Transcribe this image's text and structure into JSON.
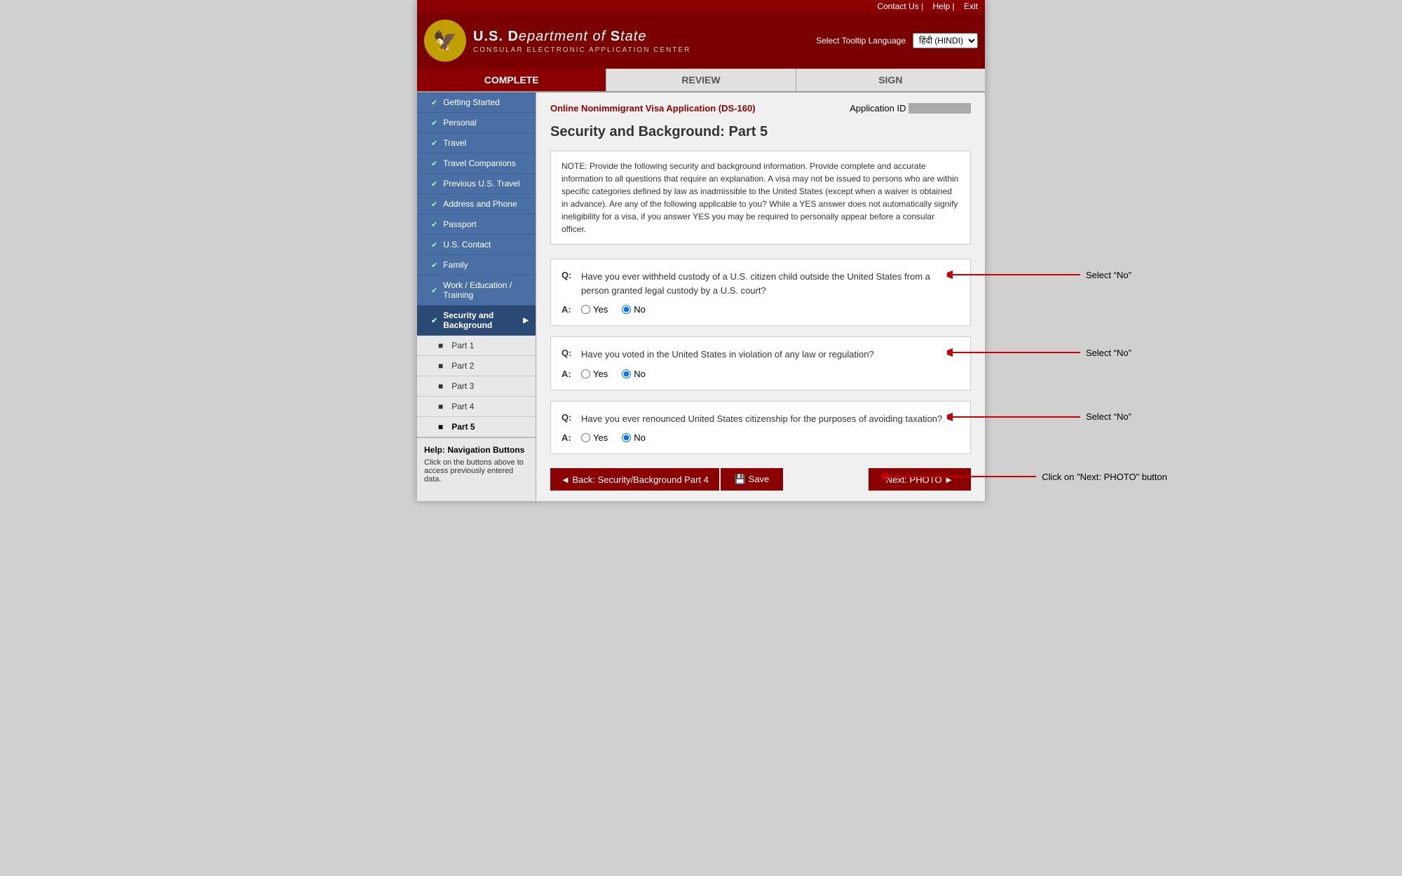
{
  "top_nav": {
    "contact_us": "Contact Us",
    "help": "Help",
    "exit": "Exit",
    "tooltip_label": "Select Tooltip Language",
    "language_selected": "हिंदी (HINDI)"
  },
  "agency": {
    "dept_line1": "U.S. DEPARTMENT",
    "dept_line2": "of STATE",
    "sub_title": "CONSULAR ELECTRONIC APPLICATION CENTER"
  },
  "tabs": [
    {
      "label": "COMPLETE",
      "state": "active"
    },
    {
      "label": "REVIEW",
      "state": "inactive"
    },
    {
      "label": "SIGN",
      "state": "inactive"
    }
  ],
  "page_header": {
    "form_title": "Online Nonimmigrant Visa Application (DS-160)",
    "app_id_label": "Application ID"
  },
  "page_title": "Security and Background: Part 5",
  "note_text": "NOTE: Provide the following security and background information. Provide complete and accurate information to all questions that require an explanation. A visa may not be issued to persons who are within specific categories defined by law as inadmissible to the United States (except when a waiver is obtained in advance). Are any of the following applicable to you? While a YES answer does not automatically signify ineligibility for a visa, if you answer YES you may be required to personally appear before a consular officer.",
  "sidebar": {
    "items": [
      {
        "id": "getting-started",
        "label": "Getting Started",
        "checked": true,
        "active": false
      },
      {
        "id": "personal",
        "label": "Personal",
        "checked": true,
        "active": false
      },
      {
        "id": "travel",
        "label": "Travel",
        "checked": true,
        "active": false
      },
      {
        "id": "travel-companions",
        "label": "Travel Companions",
        "checked": true,
        "active": false
      },
      {
        "id": "previous-us-travel",
        "label": "Previous U.S. Travel",
        "checked": true,
        "active": false
      },
      {
        "id": "address-and-phone",
        "label": "Address and Phone",
        "checked": true,
        "active": false
      },
      {
        "id": "passport",
        "label": "Passport",
        "checked": true,
        "active": false
      },
      {
        "id": "us-contact",
        "label": "U.S. Contact",
        "checked": true,
        "active": false
      },
      {
        "id": "family",
        "label": "Family",
        "checked": true,
        "active": false
      },
      {
        "id": "work-education",
        "label": "Work / Education / Training",
        "checked": true,
        "active": false
      },
      {
        "id": "security-background",
        "label": "Security and Background",
        "checked": true,
        "active": true,
        "hasArrow": true
      }
    ],
    "sub_items": [
      {
        "id": "part1",
        "label": "Part 1",
        "current": false
      },
      {
        "id": "part2",
        "label": "Part 2",
        "current": false
      },
      {
        "id": "part3",
        "label": "Part 3",
        "current": false
      },
      {
        "id": "part4",
        "label": "Part 4",
        "current": false
      },
      {
        "id": "part5",
        "label": "Part 5",
        "current": true
      }
    ]
  },
  "help": {
    "title": "Help: Navigation Buttons",
    "text": "Click on the buttons above to access previously entered data."
  },
  "questions": [
    {
      "id": "q1",
      "q_label": "Q:",
      "a_label": "A:",
      "question": "Have you ever withheld custody of a U.S. citizen child outside the United States from a person granted legal custody by a U.S. court?",
      "answer_yes_label": "Yes",
      "answer_no_label": "No",
      "selected": "no",
      "annotation": "Select “No”"
    },
    {
      "id": "q2",
      "q_label": "Q:",
      "a_label": "A:",
      "question": "Have you voted in the United States in violation of any law or regulation?",
      "answer_yes_label": "Yes",
      "answer_no_label": "No",
      "selected": "no",
      "annotation": "Select “No”"
    },
    {
      "id": "q3",
      "q_label": "Q:",
      "a_label": "A:",
      "question": "Have you ever renounced United States citizenship for the purposes of avoiding taxation?",
      "answer_yes_label": "Yes",
      "answer_no_label": "No",
      "selected": "no",
      "annotation": "Select “No”"
    }
  ],
  "buttons": {
    "back_label": "◄ Back: Security/Background Part 4",
    "save_label": "💾 Save",
    "next_label": "Next: PHOTO ►"
  },
  "button_annotation": "Click on \"Next: PHOTO\" button"
}
